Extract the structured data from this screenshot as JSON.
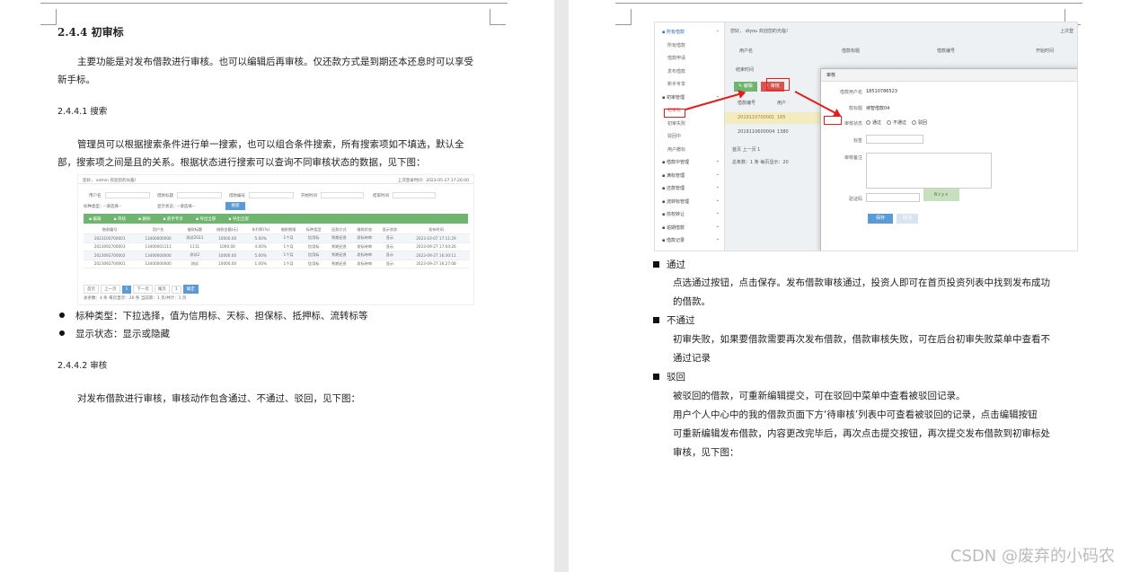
{
  "page1": {
    "heading": "2.4.4  初审标",
    "intro_line1": "主要功能是对发布借款进行审核。也可以编辑后再审核。仅还款方式是到期还本还息时可以享受",
    "intro_line2": "新手标。",
    "sub1": "2.4.4.1  搜索",
    "search_line1": "管理员可以根据搜索条件进行单一搜索，也可以组合条件搜索，所有搜索项如不填选，默认全",
    "search_line2": "部，搜索项之间是且的关系。根据状态进行搜索可以查询不同审核状态的数据，见下图：",
    "bullet1": "标种类型：下拉选择，值为信用标、天标、担保标、抵押标、流转标等",
    "bullet2": "显示状态：显示或隐藏",
    "sub2": "2.4.4.2  审核",
    "audit_line": "对发布借款进行审核，审核动作包含通过、不通过、驳回，见下图："
  },
  "shot1": {
    "topbar_left": "您好，  admin  欢迎您的光临！",
    "topbar_right": "上次登录时间：2023-05-27 17:26:00",
    "filter_user": "用户名",
    "filter_title": "借款标题",
    "filter_no": "借款编号",
    "filter_start": "开始时间",
    "filter_end": "结束时间",
    "filter_type": "标种类型：",
    "filter_type_val": "--请选择--",
    "filter_show": "显示状态：",
    "filter_show_val": "--请选择--",
    "search_btn": "搜索",
    "toolbar": [
      "编辑",
      "审核",
      "删除",
      "新手专享",
      "导出全部",
      "导出全部"
    ],
    "headers": [
      "借款编号",
      "用户名",
      "借款标题",
      "借款金额(元)",
      "年利率(%)",
      "借款期限",
      "标种类型",
      "还款方式",
      "借款状态",
      "显示状态",
      "发布时间"
    ],
    "rows": [
      [
        "2023100700001",
        "13400000000",
        "测试2023",
        "10000.00",
        "5.00%",
        "1个月",
        "信用标",
        "到期还息",
        "发标待审",
        "显示",
        "2023-10-07 17:11:29"
      ],
      [
        "2023092700003",
        "13400001111",
        "1111",
        "1000.00",
        "4.00%",
        "1个月",
        "信用标",
        "到期还息",
        "发标待审",
        "显示",
        "2023-09-27 17:04:26"
      ],
      [
        "2023092700002",
        "13400000000",
        "测试2",
        "10000.00",
        "5.00%",
        "1个月",
        "信用标",
        "到期还息",
        "发标待审",
        "显示",
        "2023-09-27 16:30:11"
      ],
      [
        "2023092700001",
        "13400000000",
        "测试",
        "10000.00",
        "1.00%",
        "1个月",
        "信用标",
        "到期还息",
        "发标待审",
        "显示",
        "2023-09-27 16:27:08"
      ]
    ],
    "pager": [
      "首页",
      "上一页",
      "1",
      "下一页",
      "尾页",
      "1",
      "确定"
    ],
    "pager_info": "总条数：4 条  每页显示：20 条  当前第：1 页/共计：1 页"
  },
  "shot2": {
    "sidebar": [
      {
        "label": "所有借款",
        "kind": "grp"
      },
      {
        "label": "所有借款",
        "kind": "sub"
      },
      {
        "label": "借款申请",
        "kind": "sub"
      },
      {
        "label": "发布借款",
        "kind": "sub"
      },
      {
        "label": "新手专享",
        "kind": "sub"
      },
      {
        "label": "初审管理",
        "kind": "grp"
      },
      {
        "label": "初审标",
        "kind": "sub"
      },
      {
        "label": "初审失败",
        "kind": "sub"
      },
      {
        "label": "驳回中",
        "kind": "sub"
      },
      {
        "label": "用户撤标",
        "kind": "sub"
      },
      {
        "label": "借款中管理",
        "kind": "grp"
      },
      {
        "label": "满标管理",
        "kind": "grp"
      },
      {
        "label": "还款管理",
        "kind": "grp"
      },
      {
        "label": "流转标管理",
        "kind": "grp"
      },
      {
        "label": "债权转让",
        "kind": "grp"
      },
      {
        "label": "逾期借款",
        "kind": "grp"
      },
      {
        "label": "借款记录",
        "kind": "grp"
      }
    ],
    "greeting": "您好，  diyou  欢迎您的光临！",
    "top_right": "上次登",
    "f_user": "用户名",
    "f_title": "借款标题",
    "f_no": "借款编号",
    "f_start": "开始时间",
    "f_end": "结束时间",
    "btn_edit": "编辑",
    "btn_audit": "审核",
    "col_no": "借款编号",
    "col_u": "用户",
    "row1_no": "2019110700001",
    "row1_u": "185",
    "row2_no": "2019110600004",
    "row2_u": "1380",
    "pager": "首页   上一页   1",
    "pager_info": "总条数：1 条  每页显示：20",
    "modal_title": "审核",
    "m_user_lbl": "借款用户名",
    "m_user_val": "18510786523",
    "m_title_lbl": "款标题",
    "m_title_val": "待智借款04",
    "m_status_lbl": "审核状态",
    "m_opts": [
      "通过",
      "不通过",
      "驳回"
    ],
    "m_tag_lbl": "标签",
    "m_note_lbl": "审核备注",
    "m_code_lbl": "验证码",
    "m_captcha": "Ncyx",
    "m_save": "保存",
    "m_cancel": "取消",
    "win_ctrl": "— ◻ ✕"
  },
  "page2": {
    "b1": "通过",
    "b1_l1": "点选通过按钮，点击保存。发布借款审核通过，投资人即可在首页投资列表中找到发布成功",
    "b1_l2": "的借款。",
    "b2": "不通过",
    "b2_l1": "初审失败，如果要借款需要再次发布借款，借款审核失败，可在后台初审失败菜单中查看不",
    "b2_l2": "通过记录",
    "b3": "驳回",
    "b3_l1": "被驳回的借款，可重新编辑提交，可在驳回中菜单中查看被驳回记录。",
    "b3_l2": "用户个人中心中的我的借款页面下方‘待审核’列表中可查看被驳回的记录，点击编辑按钮",
    "b3_l3": "可重新编辑发布借款，内容更改完毕后，再次点击提交按钮，再次提交发布借款到初审标处",
    "b3_l4": "审核，见下图："
  },
  "watermark": "CSDN @废弃的小码农"
}
